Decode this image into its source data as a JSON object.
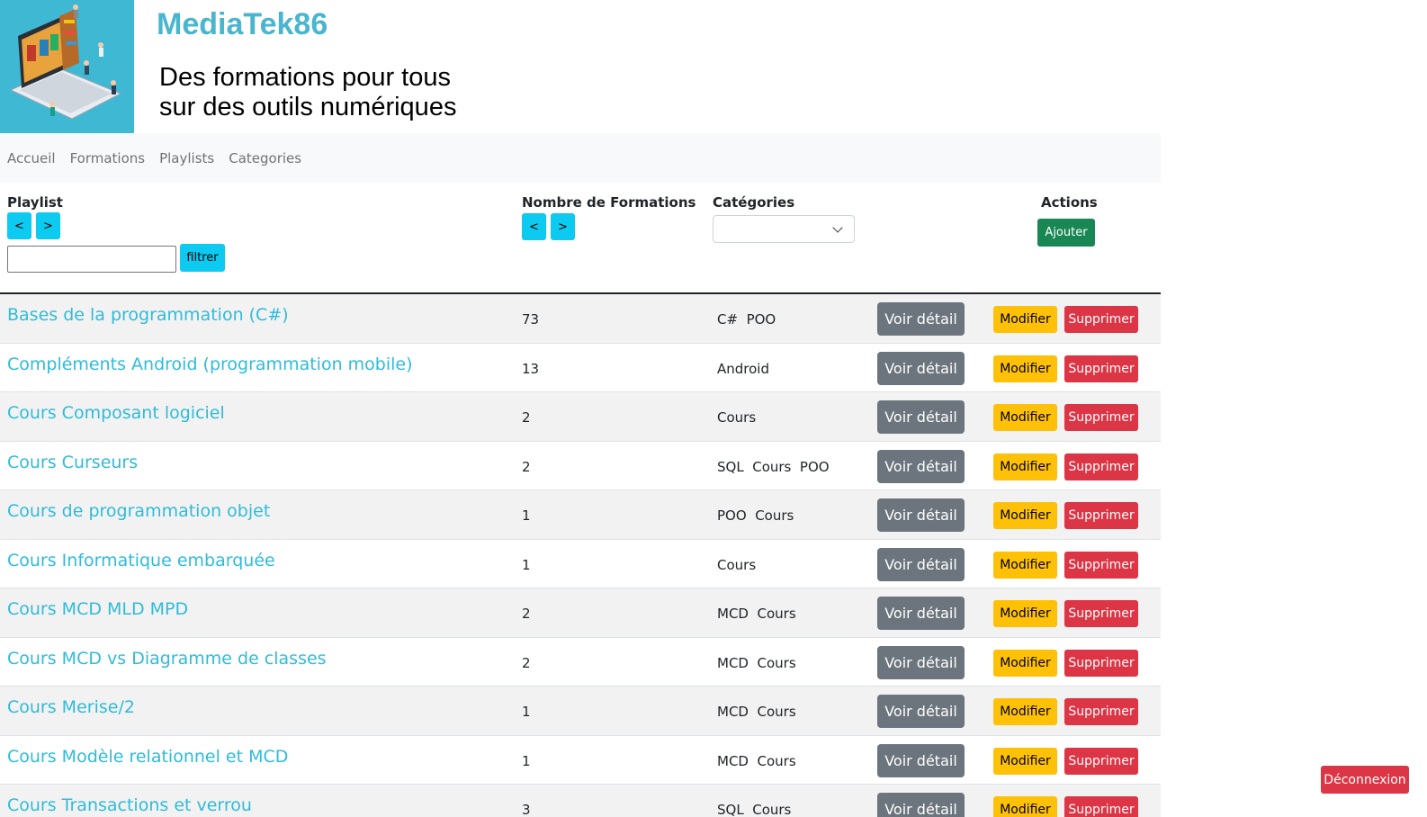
{
  "header": {
    "site_title": "MediaTek86",
    "tagline_line1": "Des formations pour tous",
    "tagline_line2": "sur des outils numériques",
    "logo_icon": "laptop-library-illustration"
  },
  "nav": {
    "items": [
      {
        "label": "Accueil"
      },
      {
        "label": "Formations"
      },
      {
        "label": "Playlists"
      },
      {
        "label": "Categories"
      }
    ]
  },
  "table_header": {
    "playlist_label": "Playlist",
    "count_label": "Nombre de Formations",
    "categories_label": "Catégories",
    "actions_label": "Actions",
    "sort_asc": "<",
    "sort_desc": ">",
    "filter_value": "",
    "filter_button": "filtrer",
    "category_selected": "",
    "add_button": "Ajouter"
  },
  "rows": [
    {
      "title": "Bases de la programmation (C#)",
      "count": "73",
      "categories": "C#  POO"
    },
    {
      "title": "Compléments Android (programmation mobile)",
      "count": "13",
      "categories": "Android"
    },
    {
      "title": "Cours Composant logiciel",
      "count": "2",
      "categories": "Cours"
    },
    {
      "title": "Cours Curseurs",
      "count": "2",
      "categories": "SQL  Cours  POO"
    },
    {
      "title": "Cours de programmation objet",
      "count": "1",
      "categories": "POO  Cours"
    },
    {
      "title": "Cours Informatique embarquée",
      "count": "1",
      "categories": "Cours"
    },
    {
      "title": "Cours MCD MLD MPD",
      "count": "2",
      "categories": "MCD  Cours"
    },
    {
      "title": "Cours MCD vs Diagramme de classes",
      "count": "2",
      "categories": "MCD  Cours"
    },
    {
      "title": "Cours Merise/2",
      "count": "1",
      "categories": "MCD  Cours"
    },
    {
      "title": "Cours Modèle relationnel et MCD",
      "count": "1",
      "categories": "MCD  Cours"
    },
    {
      "title": "Cours Transactions et verrou",
      "count": "3",
      "categories": "SQL  Cours"
    }
  ],
  "row_actions": {
    "detail": "Voir détail",
    "edit": "Modifier",
    "delete": "Supprimer"
  },
  "logout_button": "Déconnexion",
  "colors": {
    "accent": "#0dcaf0",
    "title_link": "#30bbd9",
    "success": "#198754",
    "warning": "#ffc107",
    "danger": "#dc3545",
    "secondary": "#6c757d"
  }
}
